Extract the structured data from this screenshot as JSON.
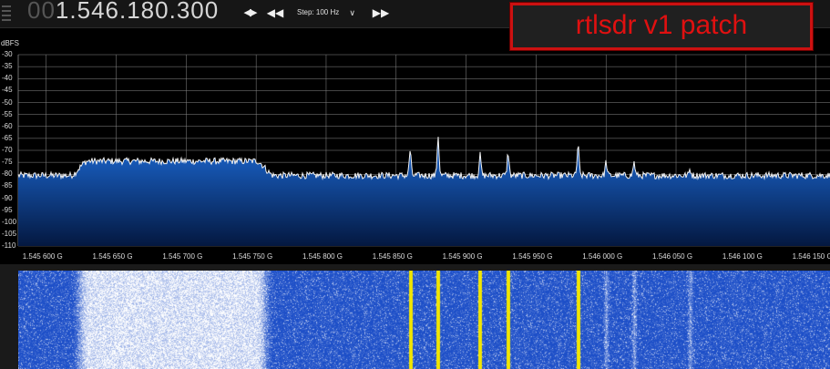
{
  "toolbar": {
    "freq_dim": "00",
    "freq_main": "1.546.180.300",
    "step_label": "Step: 100 Hz",
    "annotation": "rtlsdr v1 patch"
  },
  "colors": {
    "background": "#000000",
    "grid": "#8a8a8a",
    "trace": "#f2f2f2",
    "fill_top": "#1c6bd8",
    "fill_bottom": "#041840",
    "waterfall_base": "#1d4fc8",
    "waterfall_hot": "#ffffff",
    "waterfall_signal": "#f2e600",
    "annotation": "#e01010"
  },
  "chart_data": {
    "type": "line",
    "y_unit": "dBFS",
    "ylim": [
      -110,
      -30
    ],
    "y_ticks": [
      "-30",
      "-35",
      "-40",
      "-45",
      "-50",
      "-55",
      "-60",
      "-65",
      "-70",
      "-75",
      "-80",
      "-85",
      "-90",
      "-95",
      "-100",
      "-105",
      "-110"
    ],
    "xlim_ghz": [
      1.54558,
      1.54616
    ],
    "x_ticks": [
      {
        "value": 1.5456,
        "label": "1.545 600 G"
      },
      {
        "value": 1.54565,
        "label": "1.545 650 G"
      },
      {
        "value": 1.5457,
        "label": "1.545 700 G"
      },
      {
        "value": 1.54575,
        "label": "1.545 750 G"
      },
      {
        "value": 1.5458,
        "label": "1.545 800 G"
      },
      {
        "value": 1.54585,
        "label": "1.545 850 G"
      },
      {
        "value": 1.5459,
        "label": "1.545 900 G"
      },
      {
        "value": 1.54595,
        "label": "1.545 950 G"
      },
      {
        "value": 1.546,
        "label": "1.546 000 G"
      },
      {
        "value": 1.54605,
        "label": "1.546 050 G"
      },
      {
        "value": 1.5461,
        "label": "1.546 100 G"
      },
      {
        "value": 1.54615,
        "label": "1.546 150 G"
      }
    ],
    "grid": true,
    "noise_floor_db": -80.5,
    "plateau": {
      "start_ghz": 1.54563,
      "end_ghz": 1.54575,
      "level_db": -74.5
    },
    "peaks": [
      {
        "freq_ghz": 1.54586,
        "db": -70
      },
      {
        "freq_ghz": 1.54588,
        "db": -64
      },
      {
        "freq_ghz": 1.54591,
        "db": -72
      },
      {
        "freq_ghz": 1.54593,
        "db": -71
      },
      {
        "freq_ghz": 1.54598,
        "db": -68
      },
      {
        "freq_ghz": 1.546,
        "db": -75
      },
      {
        "freq_ghz": 1.54602,
        "db": -75
      },
      {
        "freq_ghz": 1.54606,
        "db": -78
      }
    ]
  }
}
